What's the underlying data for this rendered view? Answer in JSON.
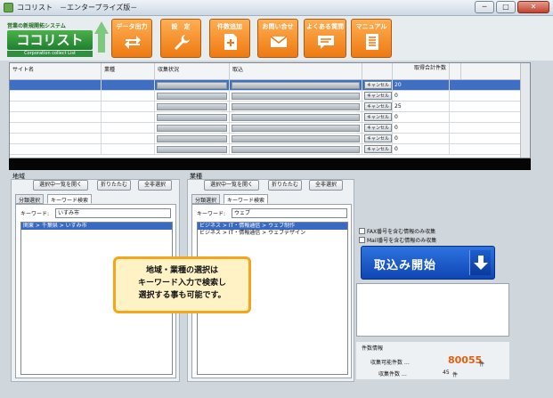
{
  "window": {
    "title": "ココリスト　－エンタープライズ版－",
    "buttons": [
      "─",
      "□",
      "✕"
    ]
  },
  "logo": {
    "tagline": "営業の新規開拓システム",
    "name": "ココリスト",
    "sub": "Corporation collect List"
  },
  "toolbar": [
    {
      "label": "データ出力",
      "icon": "arrows-icon"
    },
    {
      "label": "設　定",
      "icon": "wrench-icon"
    },
    {
      "label": "件数追加",
      "icon": "add-document-icon"
    },
    {
      "label": "お問い合せ",
      "icon": "mail-icon"
    },
    {
      "label": "よくある質問",
      "icon": "chat-bubble-icon"
    },
    {
      "label": "マニュアル",
      "icon": "manual-icon"
    }
  ],
  "grid": {
    "headers": [
      "サイト名",
      "業種",
      "収集状況",
      "取込",
      "",
      "取得合計件数"
    ],
    "cancel_label": "キャンセル",
    "rows": [
      {
        "site": "",
        "industry": "",
        "count": "20"
      },
      {
        "site": "",
        "industry": "",
        "count": "0"
      },
      {
        "site": "",
        "industry": "",
        "count": "25"
      },
      {
        "site": "",
        "industry": "",
        "count": "0"
      },
      {
        "site": "",
        "industry": "",
        "count": "0"
      },
      {
        "site": "",
        "industry": "",
        "count": "0"
      },
      {
        "site": "",
        "industry": "",
        "count": "0"
      }
    ]
  },
  "left": {
    "title": "地域",
    "btn_list": "選択中一覧を開く",
    "btn_fold": "折りたたむ",
    "btn_clear": "全非選択",
    "tab_category": "分類選択",
    "tab_keyword": "キーワード検索",
    "kw_label": "キーワード:",
    "kw_value": "いすみ市",
    "list": [
      "関東 > 千葉県 > いすみ市"
    ]
  },
  "right": {
    "title": "業種",
    "btn_list": "選択中一覧を開く",
    "btn_fold": "折りたたむ",
    "btn_clear": "全非選択",
    "tab_category": "分類選択",
    "tab_keyword": "キーワード検索",
    "kw_label": "キーワード:",
    "kw_value": "ウェブ",
    "list": [
      "ビジネス > IT・情報通信 > ウェブ制作",
      "ビジネス > IT・情報通信 > ウェブデザイン"
    ]
  },
  "options": {
    "fax": "FAX番号を含む情報のみ収集",
    "mail": "Mail番号を含む情報のみ収集"
  },
  "start": {
    "label": "取込み開始"
  },
  "info": {
    "title": "件数情報",
    "available_label": "収集可能件数 …",
    "available_value": "80055",
    "available_unit": "件",
    "collected_label": "収集件数 …",
    "collected_value": "45",
    "collected_unit": "件"
  },
  "callout": {
    "lines": [
      "地域・業種の選択は",
      "キーワード入力で検索し",
      "選択する事も可能です。"
    ]
  }
}
